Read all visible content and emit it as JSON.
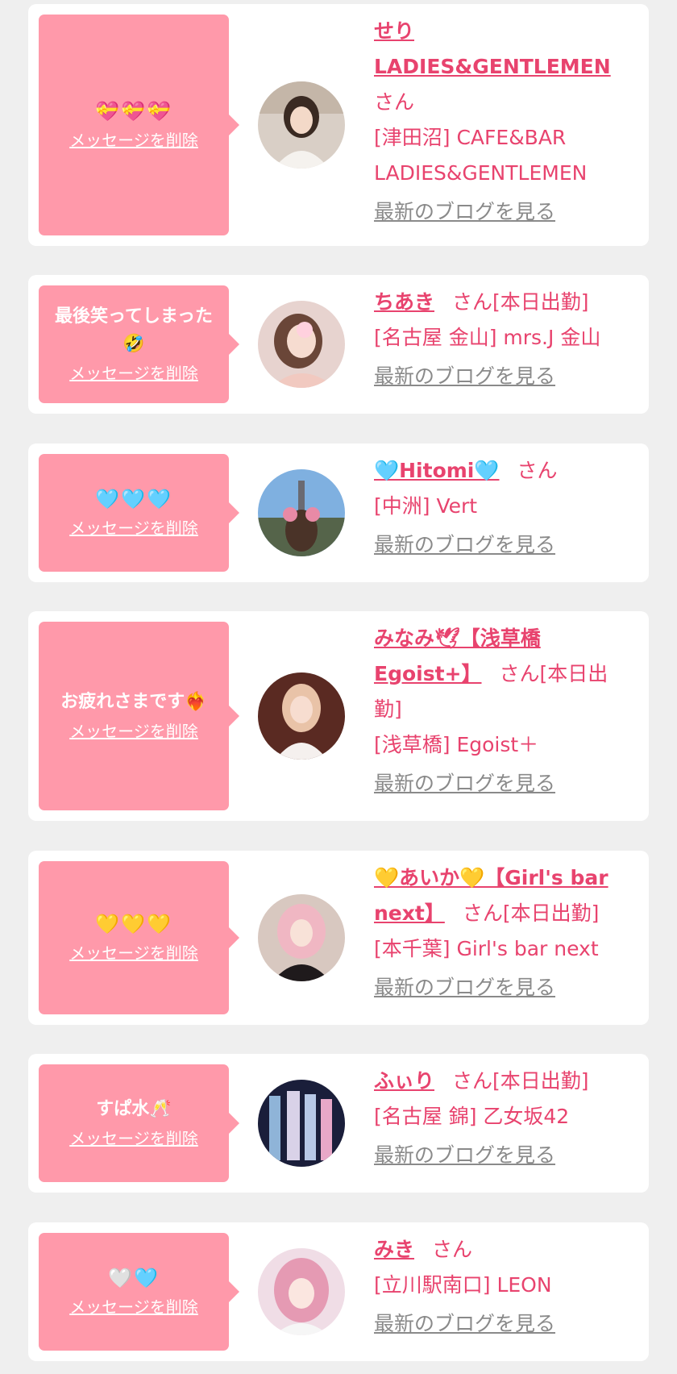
{
  "delete_label": "メッセージを削除",
  "blog_label": "最新のブログを見る",
  "colors": {
    "bubble": "#ff99aa",
    "accent": "#e8436e",
    "muted": "#8a8a8a",
    "background": "#efefef"
  },
  "cards": [
    {
      "message": "💝💝💝",
      "name": "せり LADIES&GENTLEMEN",
      "suffix": "さん",
      "shop": "[津田沼] CAFE&BAR LADIES&GENTLEMEN"
    },
    {
      "message": "最後笑ってしまった🤣",
      "name": "ちあき",
      "suffix": "さん[本日出勤]",
      "shop": "[名古屋 金山] mrs.J 金山"
    },
    {
      "message": "🩵🩵🩵",
      "name": "🩵Hitomi🩵",
      "suffix": "さん",
      "shop": "[中洲] Vert"
    },
    {
      "message": "お疲れさまです❤️‍🔥",
      "name": "みなみ🕊【浅草橋Egoist+】",
      "suffix": "さん[本日出勤]",
      "shop": "[浅草橋] Egoist＋"
    },
    {
      "message": "💛💛💛",
      "name": "💛あいか💛【Girl's bar next】",
      "suffix": "さん[本日出勤]",
      "shop": "[本千葉] Girl's bar next"
    },
    {
      "message": "すぱ水🥂",
      "name": "ふぃり",
      "suffix": "さん[本日出勤]",
      "shop": "[名古屋 錦] 乙女坂42"
    },
    {
      "message": "🤍🩵",
      "name": "みき",
      "suffix": "さん",
      "shop": "[立川駅南口] LEON"
    }
  ]
}
